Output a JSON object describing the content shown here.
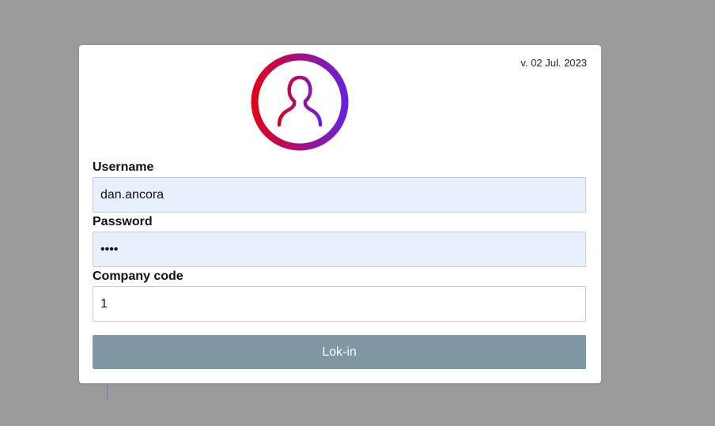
{
  "login": {
    "version": "v. 02 Jul. 2023",
    "logo_icon": "user-avatar-icon",
    "username_label": "Username",
    "username_value": "dan.ancora",
    "password_label": "Password",
    "password_value": "abcd",
    "company_label": "Company code",
    "company_value": "1",
    "login_button": "Lok-in"
  },
  "colors": {
    "backdrop": "#9b9b9b",
    "card": "#ffffff",
    "autofill_bg": "#e8f0fe",
    "button_bg": "#7e97a2",
    "logo_gradient_start": "#e0001b",
    "logo_gradient_end": "#6a1fe0"
  }
}
